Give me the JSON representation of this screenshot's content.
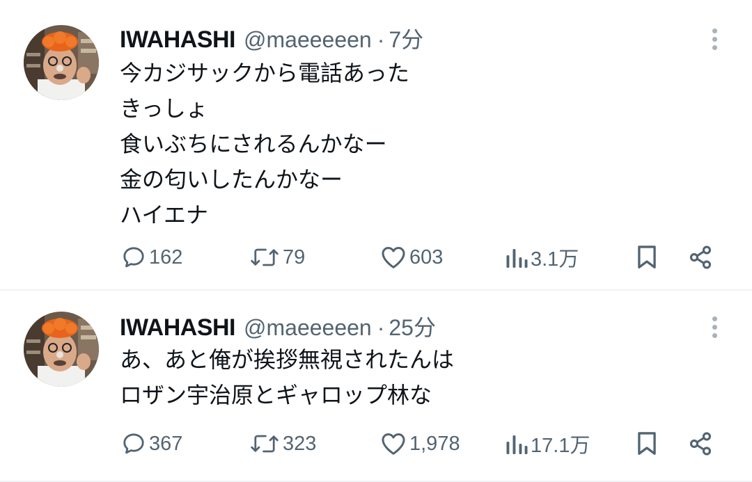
{
  "tweets": [
    {
      "display_name": "IWAHASHI",
      "handle": "@maeeeeen",
      "separator": "·",
      "time": "7分",
      "lines": [
        "今カジサックから電話あった",
        "きっしょ",
        "食いぶちにされるんかなー",
        "金の匂いしたんかなー",
        "ハイエナ"
      ],
      "replies": "162",
      "retweets": "79",
      "likes": "603",
      "views": "3.1万"
    },
    {
      "display_name": "IWAHASHI",
      "handle": "@maeeeeen",
      "separator": "·",
      "time": "25分",
      "lines": [
        "あ、あと俺が挨拶無視されたんは",
        "ロザン宇治原とギャロップ林な"
      ],
      "replies": "367",
      "retweets": "323",
      "likes": "1,978",
      "views": "17.1万"
    }
  ],
  "icons": {
    "reply": "reply-icon",
    "retweet": "retweet-icon",
    "like": "heart-icon",
    "views": "views-icon",
    "bookmark": "bookmark-icon",
    "share": "share-icon",
    "more": "more-options-icon"
  },
  "colors": {
    "text": "#0f1419",
    "secondary": "#536471",
    "divider": "#eff3f4"
  }
}
